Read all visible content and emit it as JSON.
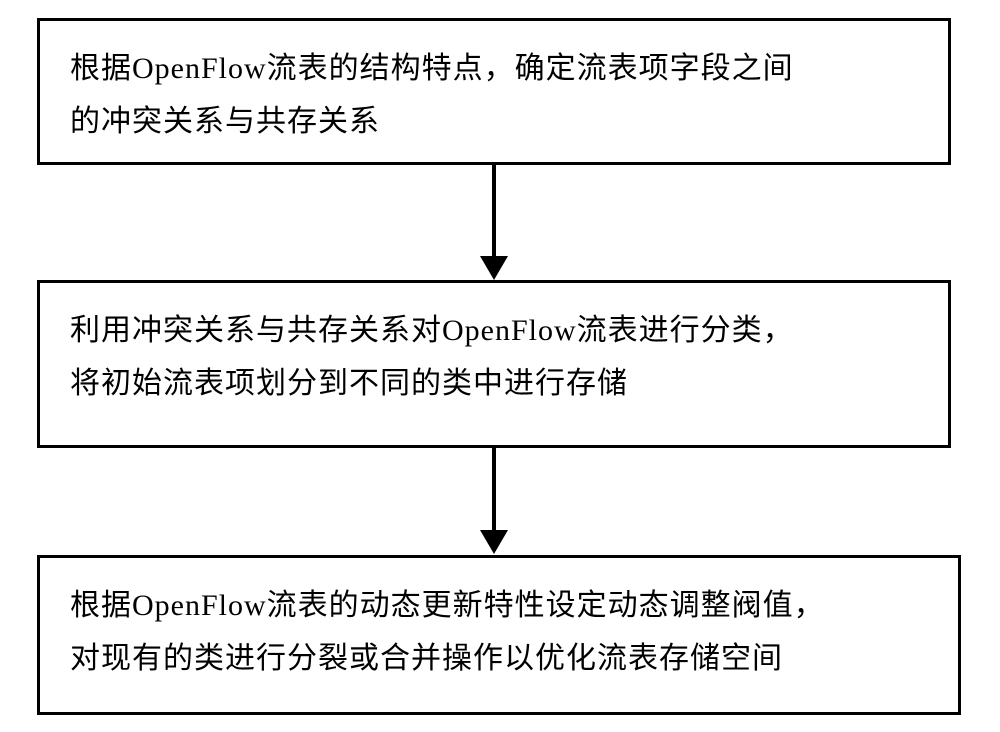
{
  "flowchart": {
    "box1": {
      "line1": "根据OpenFlow流表的结构特点，确定流表项字段之间",
      "line2": "的冲突关系与共存关系"
    },
    "box2": {
      "line1": "利用冲突关系与共存关系对OpenFlow流表进行分类，",
      "line2": "将初始流表项划分到不同的类中进行存储"
    },
    "box3": {
      "line1": "根据OpenFlow流表的动态更新特性设定动态调整阀值，",
      "line2": "对现有的类进行分裂或合并操作以优化流表存储空间"
    }
  }
}
